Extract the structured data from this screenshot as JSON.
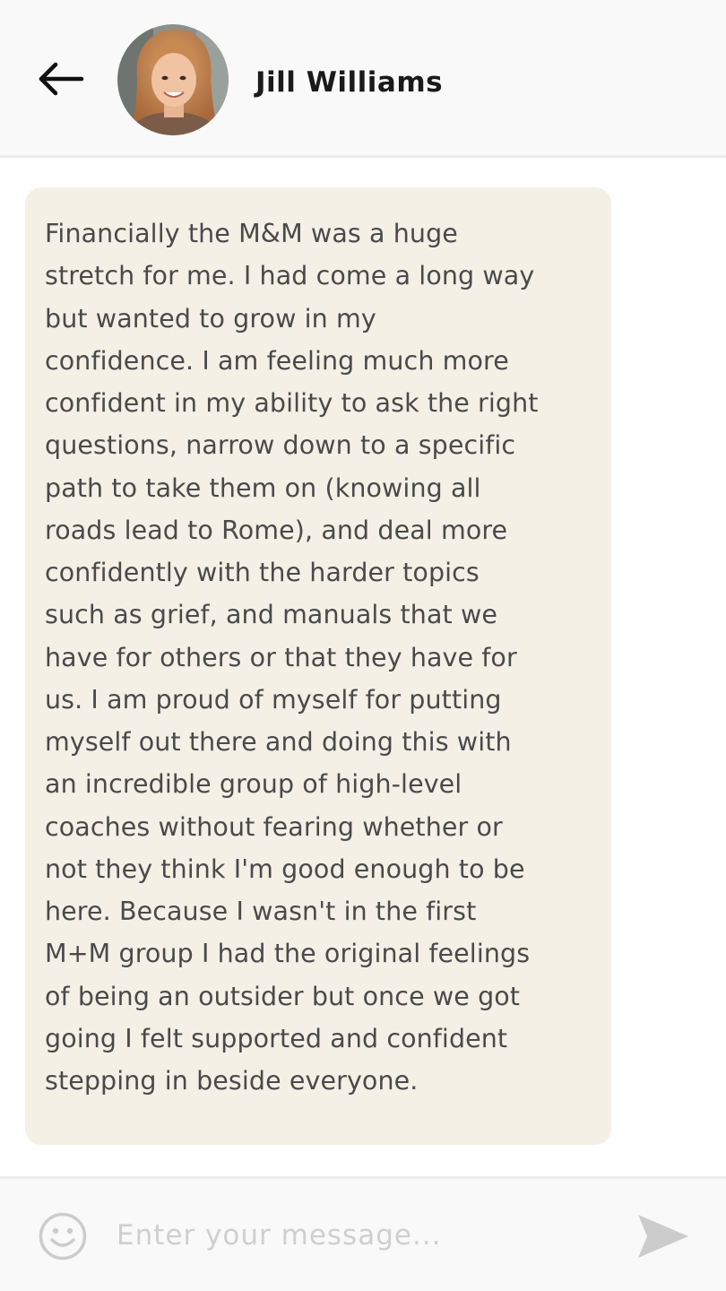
{
  "header": {
    "back_icon": "arrow-left-icon",
    "avatar_icon": "contact-avatar-photo",
    "contact_name": "Jill Williams"
  },
  "conversation": {
    "messages": [
      {
        "sender": "Jill Williams",
        "direction": "incoming",
        "text": "Financially the M&M was a huge\nstretch for me. I had come a long way\nbut wanted to grow in my\nconfidence. I am feeling much more\nconfident in my ability to ask the right\nquestions, narrow down to a specific\npath to take them on (knowing all\nroads lead to Rome), and deal more\nconfidently with the harder topics\nsuch as grief, and manuals that we\nhave for others or that they have for\nus. I am proud of myself for putting\nmyself out there and doing this with\nan incredible group of high-level\ncoaches without fearing whether or\nnot they think I'm good enough to be\nhere. Because I wasn't in the first\nM+M group I had the original feelings\nof being an outsider but once we got\ngoing I felt supported and confident\nstepping in beside everyone."
      }
    ]
  },
  "composer": {
    "emoji_icon": "smiley-face-icon",
    "placeholder": "Enter your message...",
    "value": "",
    "send_icon": "send-arrow-icon"
  },
  "colors": {
    "header_bg": "#f9f9f9",
    "bubble_bg": "#f4f0e6",
    "message_text": "#4a4a4a",
    "placeholder_text": "#cfcfcf",
    "icon_gray": "#cccccc",
    "title_text": "#1a1a1a"
  }
}
